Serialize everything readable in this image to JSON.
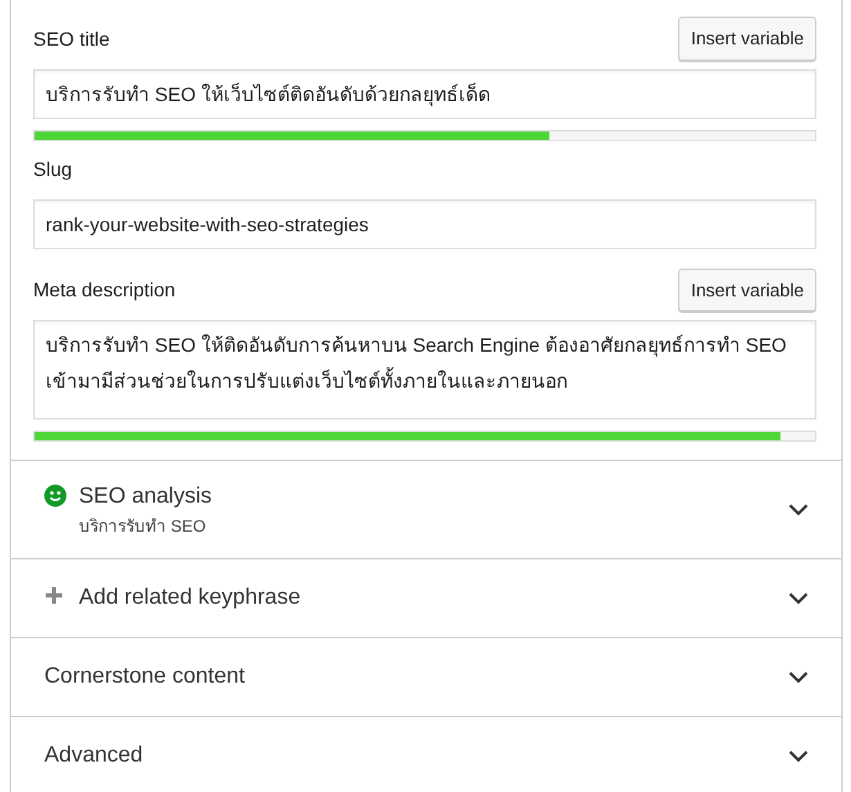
{
  "fields": [
    {
      "kind": "input",
      "label": "SEO title",
      "button": "Insert variable",
      "value": "บริการรับทำ SEO ให้เว็บไซต์ติดอันดับด้วยกลยุทธ์เด็ด",
      "level": 0.66
    },
    {
      "kind": "input",
      "label": "Slug",
      "value": "rank-your-website-with-seo-strategies"
    },
    {
      "kind": "textarea",
      "label": "Meta description",
      "button": "Insert variable",
      "value": "บริการรับทำ SEO ให้ติดอันดับการค้นหาบน Search Engine ต้องอาศัยกลยุทธ์การทำ SEO เข้ามามีส่วนช่วยในการปรับแต่งเว็บไซต์ทั้งภายในและภายนอก",
      "level": 0.955
    }
  ],
  "sections": [
    {
      "kind": "analysis",
      "title": "SEO analysis",
      "subtitle": "บริการรับทำ SEO",
      "expanded": false
    },
    {
      "kind": "add",
      "title": "Add related keyphrase",
      "expanded": false
    },
    {
      "kind": "plain",
      "title": "Cornerstone content",
      "expanded": false
    },
    {
      "kind": "plain",
      "title": "Advanced",
      "expanded": false
    }
  ]
}
